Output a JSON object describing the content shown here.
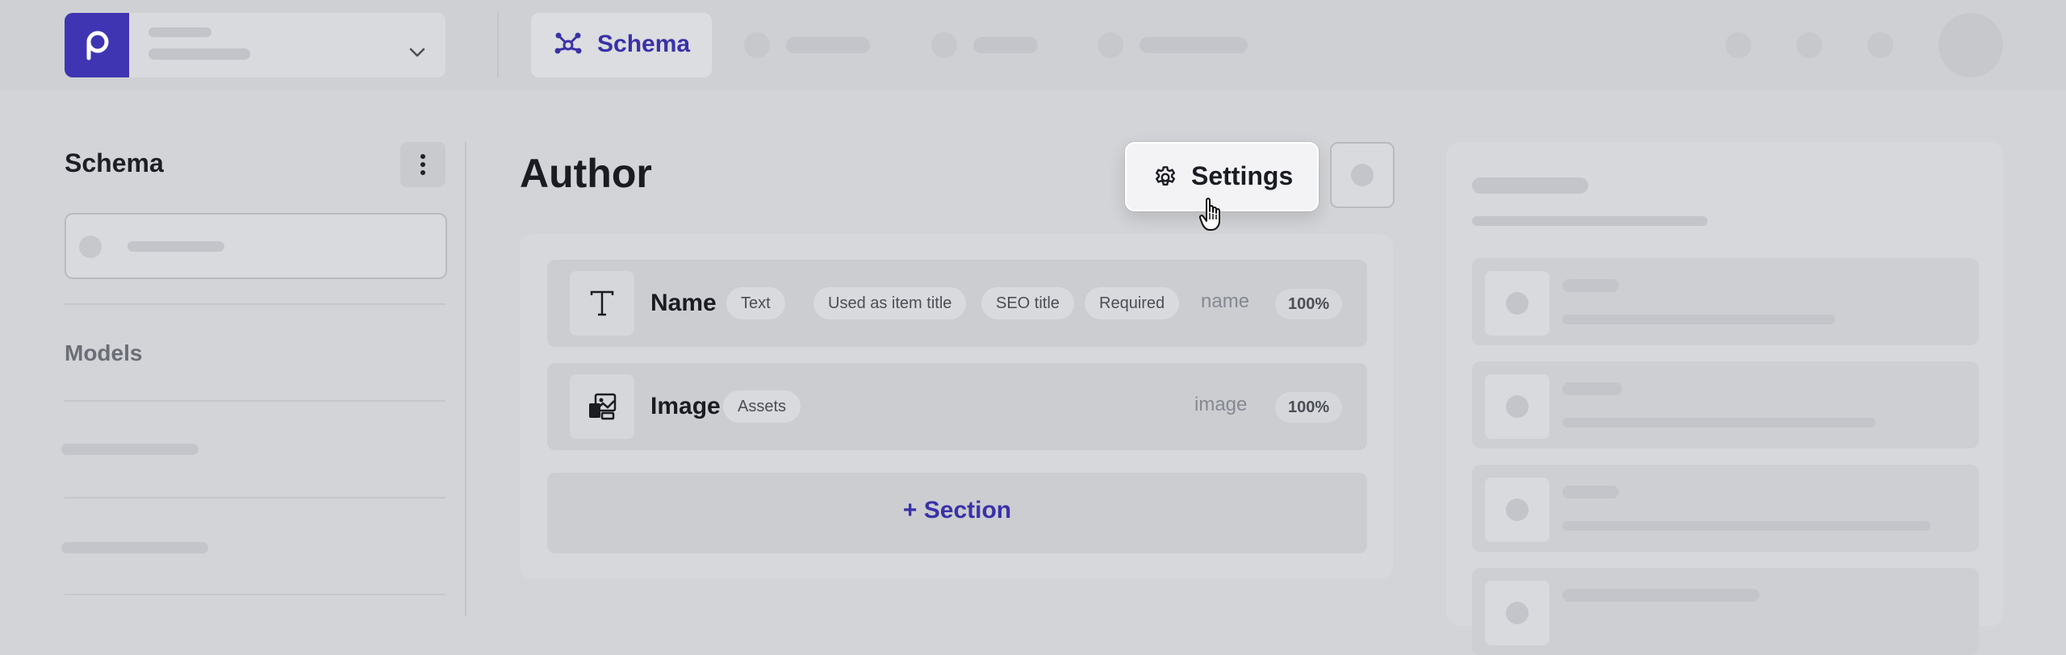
{
  "topnav": {
    "active_tab_label": "Schema",
    "icons": [
      "schema-icon",
      "chevron-down-icon",
      "logo-icon"
    ]
  },
  "sidebar": {
    "title": "Schema",
    "models_label": "Models"
  },
  "main": {
    "title": "Author",
    "settings_label": "Settings",
    "fields": [
      {
        "name": "Name",
        "icon": "text-type-icon",
        "tags": [
          "Text",
          "Used as item title",
          "SEO title",
          "Required"
        ],
        "api_key": "name",
        "completeness": "100%"
      },
      {
        "name": "Image",
        "icon": "image-assets-icon",
        "tags": [
          "Assets"
        ],
        "api_key": "image",
        "completeness": "100%"
      }
    ],
    "add_section_label": "+ Section"
  },
  "colors": {
    "accent": "#3f35b3",
    "background": "#d3d4d8"
  }
}
